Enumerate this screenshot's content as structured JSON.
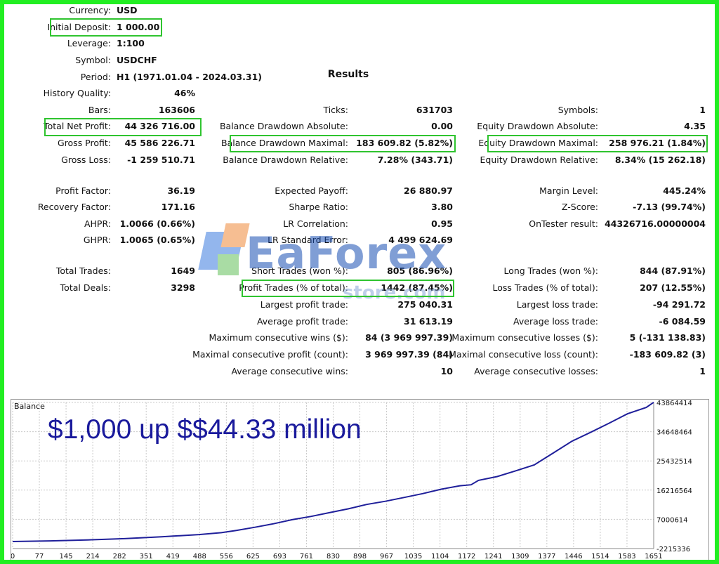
{
  "header": {
    "currency_label": "Currency:",
    "currency": "USD",
    "initial_deposit_label": "Initial Deposit:",
    "initial_deposit": "1 000.00",
    "leverage_label": "Leverage:",
    "leverage": "1:100",
    "symbol_label": "Symbol:",
    "symbol": "USDCHF",
    "period_label": "Period:",
    "period": "H1 (1971.01.04 - 2024.03.31)",
    "results_title": "Results"
  },
  "col1": [
    {
      "label": "History Quality:",
      "value": "46%"
    },
    {
      "label": "Bars:",
      "value": "163606"
    },
    {
      "label": "Total Net Profit:",
      "value": "44 326 716.00"
    },
    {
      "label": "Gross Profit:",
      "value": "45 586 226.71"
    },
    {
      "label": "Gross Loss:",
      "value": "-1 259 510.71"
    },
    {
      "label": "Profit Factor:",
      "value": "36.19"
    },
    {
      "label": "Recovery Factor:",
      "value": "171.16"
    },
    {
      "label": "AHPR:",
      "value": "1.0066 (0.66%)"
    },
    {
      "label": "GHPR:",
      "value": "1.0065 (0.65%)"
    },
    {
      "label": "Total Trades:",
      "value": "1649"
    },
    {
      "label": "Total Deals:",
      "value": "3298"
    }
  ],
  "col2": [
    {
      "label": "Ticks:",
      "value": "631703"
    },
    {
      "label": "Balance Drawdown Absolute:",
      "value": "0.00"
    },
    {
      "label": "Balance Drawdown Maximal:",
      "value": "183 609.82 (5.82%)"
    },
    {
      "label": "Balance Drawdown Relative:",
      "value": "7.28% (343.71)"
    },
    {
      "label": "Expected Payoff:",
      "value": "26 880.97"
    },
    {
      "label": "Sharpe Ratio:",
      "value": "3.80"
    },
    {
      "label": "LR Correlation:",
      "value": "0.95"
    },
    {
      "label": "LR Standard Error:",
      "value": "4 499 624.69"
    },
    {
      "label": "Short Trades (won %):",
      "value": "805 (86.96%)"
    },
    {
      "label": "Profit Trades (% of total):",
      "value": "1442 (87.45%)"
    },
    {
      "label": "Largest profit trade:",
      "value": "275 040.31"
    },
    {
      "label": "Average profit trade:",
      "value": "31 613.19"
    },
    {
      "label": "Maximum consecutive wins ($):",
      "value": "84 (3 969 997.39)"
    },
    {
      "label": "Maximal consecutive profit (count):",
      "value": "3 969 997.39 (84)"
    },
    {
      "label": "Average consecutive wins:",
      "value": "10"
    }
  ],
  "col3": [
    {
      "label": "Symbols:",
      "value": "1"
    },
    {
      "label": "Equity Drawdown Absolute:",
      "value": "4.35"
    },
    {
      "label": "Equity Drawdown Maximal:",
      "value": "258 976.21 (1.84%)"
    },
    {
      "label": "Equity Drawdown Relative:",
      "value": "8.34% (15 262.18)"
    },
    {
      "label": "Margin Level:",
      "value": "445.24%"
    },
    {
      "label": "Z-Score:",
      "value": "-7.13 (99.74%)"
    },
    {
      "label": "OnTester result:",
      "value": "44326716.00000004"
    },
    {
      "label": "Long Trades (won %):",
      "value": "844 (87.91%)"
    },
    {
      "label": "Loss Trades (% of total):",
      "value": "207 (12.55%)"
    },
    {
      "label": "Largest loss trade:",
      "value": "-94 291.72"
    },
    {
      "label": "Average loss trade:",
      "value": "-6 084.59"
    },
    {
      "label": "Maximum consecutive losses ($):",
      "value": "5 (-131 138.83)"
    },
    {
      "label": "Maximal consecutive loss (count):",
      "value": "-183 609.82 (3)"
    },
    {
      "label": "Average consecutive losses:",
      "value": "1"
    }
  ],
  "watermark": {
    "name": "EaForex",
    "sub": "store.com"
  },
  "caption": "$1,000 up $$44.33 million",
  "colors": {
    "frame": "#22ee22",
    "highlight": "#2fc42f",
    "line": "#1f1f9a",
    "caption": "#1a1a9c"
  },
  "chart_data": {
    "type": "line",
    "title": "Balance",
    "x_ticks": [
      "0",
      "77",
      "145",
      "214",
      "282",
      "351",
      "419",
      "488",
      "556",
      "625",
      "693",
      "761",
      "830",
      "898",
      "967",
      "1035",
      "1104",
      "1172",
      "1241",
      "1309",
      "1377",
      "1446",
      "1514",
      "1583",
      "1651"
    ],
    "y_ticks": [
      "43864414",
      "34648464",
      "25432514",
      "16216564",
      "7000614",
      "-2215336"
    ],
    "ylim": [
      -2215336,
      43864414
    ],
    "xlim": [
      0,
      1720
    ],
    "series": [
      {
        "x": [
          0,
          100,
          200,
          300,
          400,
          500,
          560,
          600,
          650,
          700,
          750,
          800,
          850,
          900,
          950,
          1000,
          1050,
          1100,
          1150,
          1200,
          1230,
          1250,
          1300,
          1350,
          1400,
          1450,
          1500,
          1550,
          1600,
          1650,
          1700,
          1720
        ],
        "y": [
          1000,
          200000,
          500000,
          900000,
          1500000,
          2200000,
          2800000,
          3500000,
          4500000,
          5600000,
          6900000,
          7900000,
          9100000,
          10300000,
          11700000,
          12700000,
          13900000,
          15100000,
          16500000,
          17600000,
          17900000,
          19300000,
          20500000,
          22300000,
          24200000,
          27900000,
          31600000,
          34400000,
          37300000,
          40300000,
          42300000,
          43900000
        ]
      }
    ],
    "grid": true
  }
}
